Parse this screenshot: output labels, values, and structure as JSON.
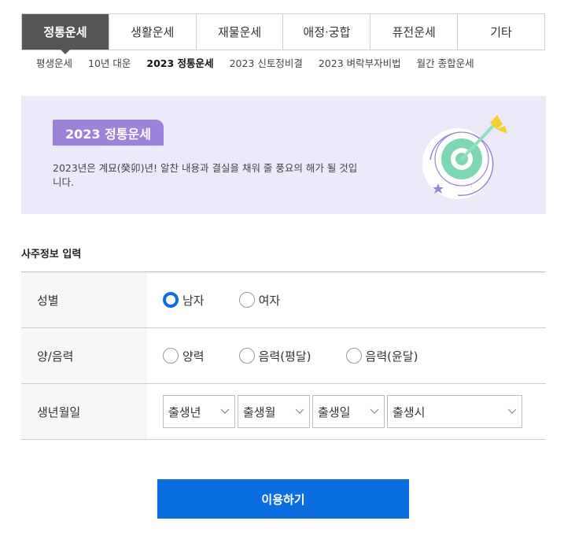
{
  "tabs": [
    {
      "label": "정통운세",
      "active": true
    },
    {
      "label": "생활운세"
    },
    {
      "label": "재물운세"
    },
    {
      "label": "애정·궁합"
    },
    {
      "label": "퓨전운세"
    },
    {
      "label": "기타"
    }
  ],
  "subnav": [
    {
      "label": "평생운세"
    },
    {
      "label": "10년 대운"
    },
    {
      "label": "2023 정통운세",
      "active": true
    },
    {
      "label": "2023 신토정비결"
    },
    {
      "label": "2023 벼락부자비법"
    },
    {
      "label": "월간 종합운세"
    }
  ],
  "banner": {
    "title": "2023 정통운세",
    "description": "2023년은 계묘(癸卯)년! 알찬 내용과 결실을 채워 줄 풍요의 해가 될 것입니다.",
    "background": "#ece9fb",
    "badge_color": "#9c83d9",
    "illustration": "target-dart-icon"
  },
  "form": {
    "section_title": "사주정보 입력",
    "gender": {
      "label": "성별",
      "options": [
        "남자",
        "여자"
      ],
      "selected": "남자"
    },
    "calendar": {
      "label": "양/음력",
      "options": [
        "양력",
        "음력(평달)",
        "음력(윤달)"
      ],
      "selected": null
    },
    "birth": {
      "label": "생년월일",
      "year_placeholder": "출생년",
      "month_placeholder": "출생월",
      "day_placeholder": "출생일",
      "hour_placeholder": "출생시"
    }
  },
  "submit_label": "이용하기",
  "accent_color": "#0a6de0"
}
